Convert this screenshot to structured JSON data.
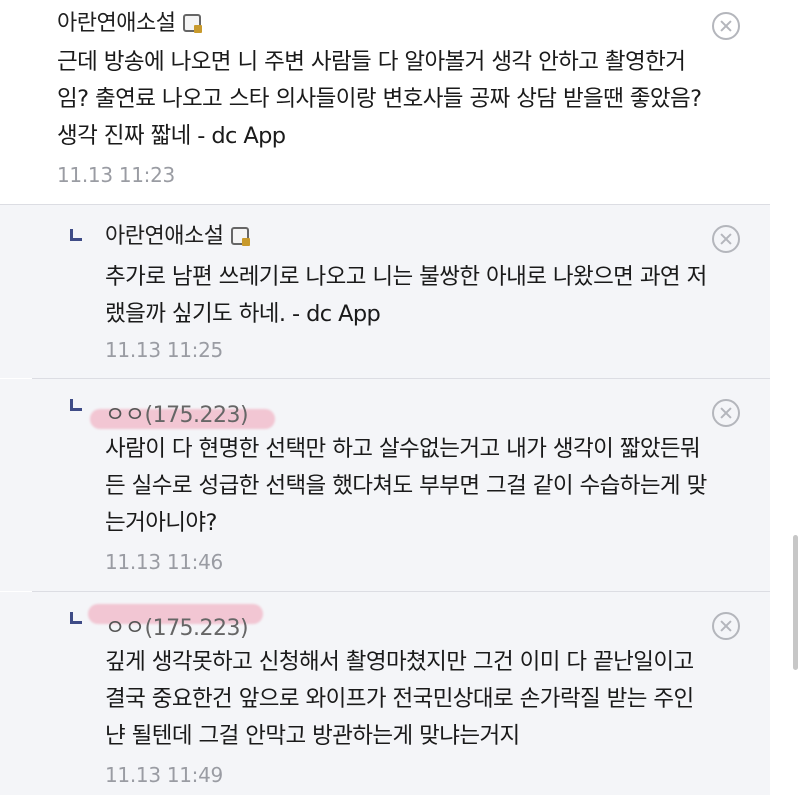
{
  "comments": [
    {
      "nickname": "아란연애소설",
      "text_lines": [
        "근데 방송에 나오면 니 주변 사람들 다 알아볼거 생각 안하고 촬영한거",
        "임? 출연료 나오고 스타 의사들이랑 변호사들 공짜 상담 받을땐 좋았음?",
        "생각 진짜 짧네 - dc App"
      ],
      "time": "11.13 11:23"
    },
    {
      "nickname": "아란연애소설",
      "text_lines": [
        "추가로 남편 쓰레기로 나오고 니는 불쌍한 아내로 나왔으면 과연 저",
        "랬을까 싶기도 하네. - dc App"
      ],
      "time": "11.13 11:25"
    },
    {
      "nickname": "ㅇㅇ",
      "ip": "(175.223)",
      "text_lines": [
        "사람이 다 현명한 선택만 하고 살수없는거고 내가 생각이 짧았든뭐",
        "든 실수로 성급한 선택을 했다쳐도 부부면 그걸 같이 수습하는게 맞",
        "는거아니야?"
      ],
      "time": "11.13 11:46"
    },
    {
      "nickname": "ㅇㅇ",
      "ip": "(175.223)",
      "text_lines": [
        "깊게 생각못하고 신청해서 촬영마쳤지만 그건 이미 다 끝난일이고",
        "결국 중요한건 앞으로 와이프가 전국민상대로 손가락질 받는 주인",
        "냔 될텐데 그걸 안막고 방관하는게 맞냐는거지"
      ],
      "time": "11.13 11:49"
    }
  ],
  "colors": {
    "reply_bg": "#f4f5f8",
    "divider": "#dcdde3",
    "reply_arrow": "#3e4b86",
    "timestamp": "#9a9ca3",
    "highlight": "#f07896"
  },
  "icons": {
    "badge": "fixed-nick-badge-icon",
    "delete": "delete-circle-x-icon",
    "reply": "reply-arrow-icon"
  }
}
